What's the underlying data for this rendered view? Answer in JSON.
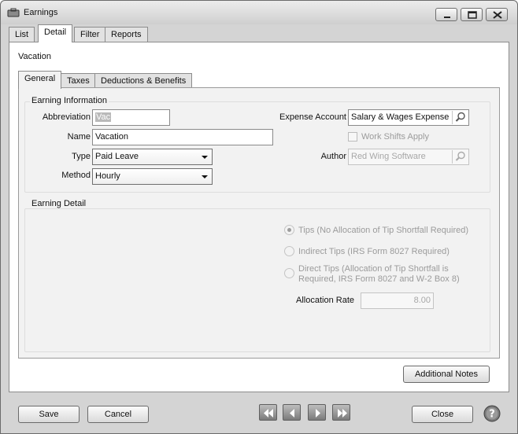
{
  "window": {
    "title": "Earnings"
  },
  "main_tabs": [
    "List",
    "Detail",
    "Filter",
    "Reports"
  ],
  "record_title": "Vacation",
  "sub_tabs": [
    "General",
    "Taxes",
    "Deductions & Benefits"
  ],
  "earning_info": {
    "group_label": "Earning Information",
    "abbreviation_label": "Abbreviation",
    "abbreviation_value": "Vac",
    "name_label": "Name",
    "name_value": "Vacation",
    "type_label": "Type",
    "type_value": "Paid Leave",
    "method_label": "Method",
    "method_value": "Hourly",
    "expense_account_label": "Expense Account",
    "expense_account_value": "Salary & Wages Expense",
    "work_shifts_label": "Work Shifts Apply",
    "author_label": "Author",
    "author_value": "Red Wing Software"
  },
  "earning_detail": {
    "group_label": "Earning Detail",
    "tips_label": "Tips (No Allocation of Tip Shortfall Required)",
    "indirect_tips_label": "Indirect Tips (IRS Form 8027 Required)",
    "direct_tips_line1": "Direct Tips (Allocation of Tip Shortfall is",
    "direct_tips_line2": "Required, IRS Form 8027 and W-2 Box 8)",
    "allocation_rate_label": "Allocation Rate",
    "allocation_rate_value": "8.00"
  },
  "buttons": {
    "additional_notes": "Additional Notes",
    "save": "Save",
    "cancel": "Cancel",
    "close": "Close"
  },
  "icons": {
    "app": "briefcase-icon",
    "minimize": "minimize-icon",
    "maximize": "maximize-icon",
    "close": "close-icon",
    "lookup": "magnifier-icon",
    "first": "first-record-icon",
    "previous": "previous-record-icon",
    "next": "next-record-icon",
    "last": "last-record-icon",
    "help": "help-icon"
  }
}
